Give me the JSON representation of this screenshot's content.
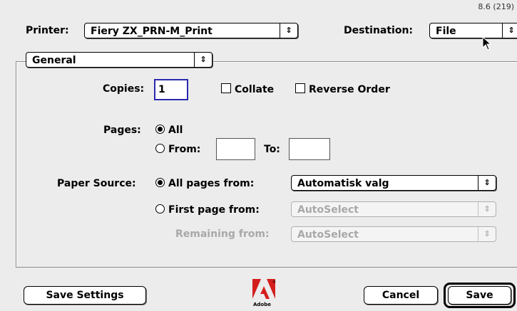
{
  "version": "8.6 (219)",
  "printer": {
    "label": "Printer:",
    "value": "Fiery ZX_PRN-M_Print"
  },
  "destination": {
    "label": "Destination:",
    "value": "File"
  },
  "section": {
    "value": "General"
  },
  "copies": {
    "label": "Copies:",
    "value": "1"
  },
  "collate": {
    "label": "Collate",
    "checked": false
  },
  "reverse_order": {
    "label": "Reverse Order",
    "checked": false
  },
  "pages": {
    "label": "Pages:",
    "all_label": "All",
    "from_label": "From:",
    "to_label": "To:",
    "from_value": "",
    "to_value": "",
    "selected": "All"
  },
  "paper_source": {
    "label": "Paper Source:",
    "all_pages_label": "All pages from:",
    "all_pages_value": "Automatisk valg",
    "first_page_label": "First page from:",
    "first_page_value": "AutoSelect",
    "remaining_label": "Remaining from:",
    "remaining_value": "AutoSelect",
    "selected": "All pages from:"
  },
  "buttons": {
    "save_settings": "Save Settings",
    "cancel": "Cancel",
    "save": "Save"
  },
  "logo": {
    "text": "Adobe"
  },
  "colors": {
    "accent": "#2a2ab0",
    "background": "#ececec",
    "disabled_text": "#a8a8a8"
  }
}
